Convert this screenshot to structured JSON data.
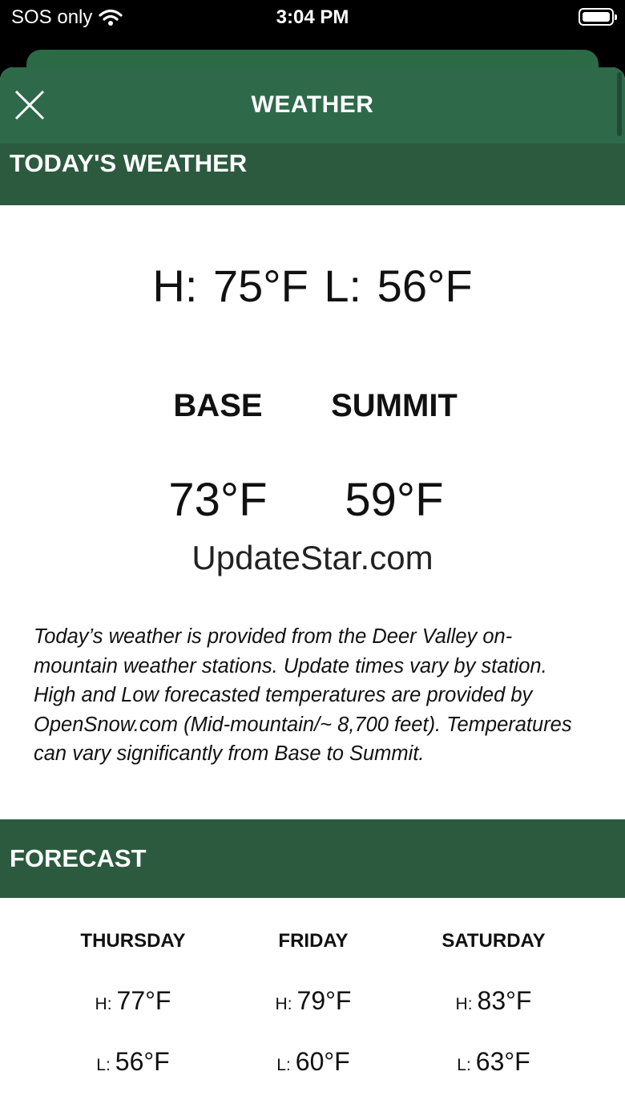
{
  "status_bar": {
    "carrier": "SOS only",
    "time": "3:04 PM"
  },
  "header": {
    "title": "WEATHER"
  },
  "today": {
    "section_title": "TODAY'S WEATHER",
    "hilo": "H: 75°F  L: 56°F",
    "base_label": "BASE",
    "summit_label": "SUMMIT",
    "base_temp": "73°F",
    "summit_temp": "59°F",
    "watermark": "UpdateStar.com",
    "description": "Today’s weather is provided from the Deer Valley on-mountain weather stations. Update times vary by station. High and Low forecasted temperatures are provided by OpenSnow.com (Mid-mountain/~ 8,700 feet). Temperatures can vary significantly from Base to Summit."
  },
  "forecast": {
    "section_title": "FORECAST",
    "high_prefix": "H:",
    "low_prefix": "L:",
    "days": [
      {
        "name": "THURSDAY",
        "high": "77°F",
        "low": "56°F"
      },
      {
        "name": "FRIDAY",
        "high": "79°F",
        "low": "60°F"
      },
      {
        "name": "SATURDAY",
        "high": "83°F",
        "low": "63°F"
      }
    ]
  },
  "colors": {
    "header_green": "#2e6a4a",
    "band_green": "#2c5a3f"
  }
}
